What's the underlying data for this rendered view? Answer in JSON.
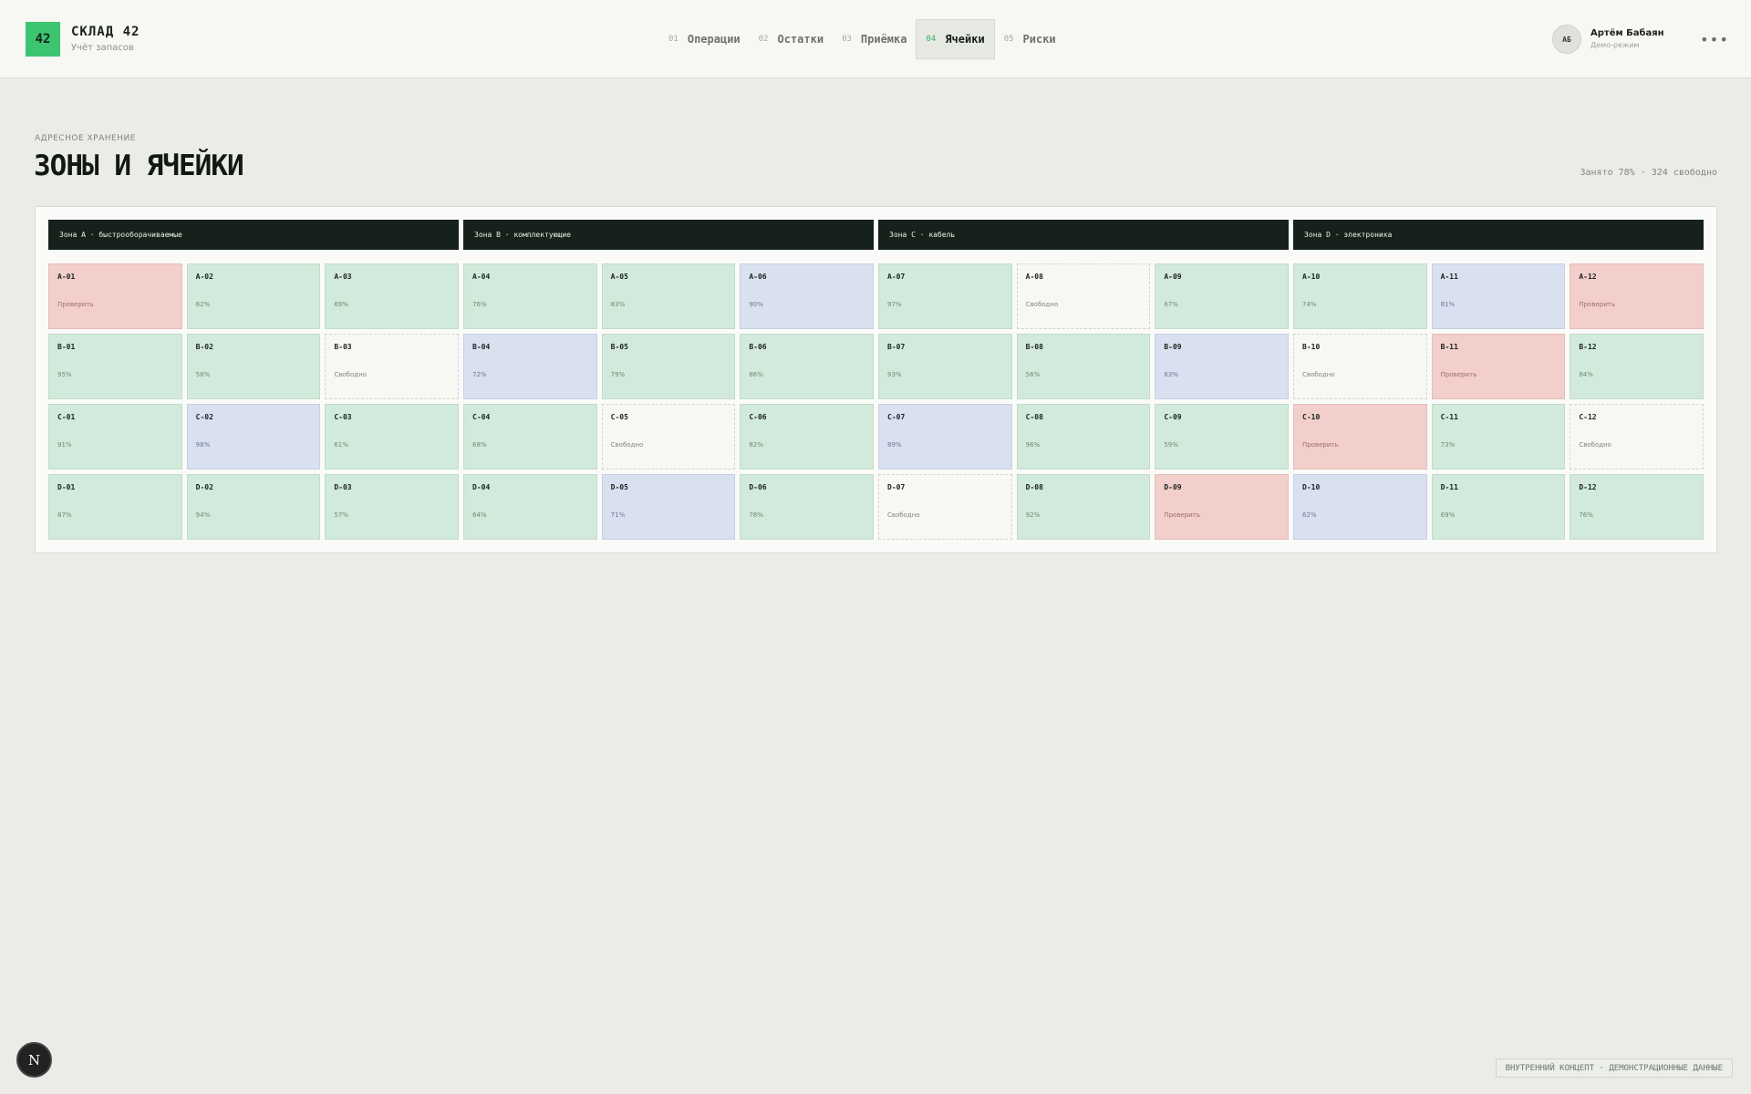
{
  "header": {
    "logo_text": "42",
    "brand_title": "СКЛАД 42",
    "brand_subtitle": "Учёт запасов",
    "nav": [
      {
        "num": "01",
        "label": "Операции"
      },
      {
        "num": "02",
        "label": "Остатки"
      },
      {
        "num": "03",
        "label": "Приёмка"
      },
      {
        "num": "04",
        "label": "Ячейки",
        "active": true
      },
      {
        "num": "05",
        "label": "Риски"
      }
    ],
    "user": {
      "initials": "АБ",
      "name": "Артём Бабаян",
      "role": "Демо-режим"
    },
    "more_label": "•••"
  },
  "page": {
    "eyebrow": "АДРЕСНОЕ ХРАНЕНИЕ",
    "title": "ЗОНЫ И ЯЧЕЙКИ",
    "occupancy": "Занято 78% · 324 свободно"
  },
  "zones": [
    "Зона A · быстрооборачиваемые",
    "Зона B · комплектующие",
    "Зона C · кабель",
    "Зона D · электроника"
  ],
  "cells": [
    [
      {
        "id": "A-01",
        "value": "Проверить",
        "status": "warn"
      },
      {
        "id": "A-02",
        "value": "62%",
        "status": "ok"
      },
      {
        "id": "A-03",
        "value": "69%",
        "status": "ok"
      },
      {
        "id": "A-04",
        "value": "76%",
        "status": "ok"
      },
      {
        "id": "A-05",
        "value": "83%",
        "status": "ok"
      },
      {
        "id": "A-06",
        "value": "90%",
        "status": "info"
      },
      {
        "id": "A-07",
        "value": "97%",
        "status": "ok"
      },
      {
        "id": "A-08",
        "value": "Свободно",
        "status": "free"
      },
      {
        "id": "A-09",
        "value": "67%",
        "status": "ok"
      },
      {
        "id": "A-10",
        "value": "74%",
        "status": "ok"
      },
      {
        "id": "A-11",
        "value": "81%",
        "status": "info"
      },
      {
        "id": "A-12",
        "value": "Проверить",
        "status": "warn"
      }
    ],
    [
      {
        "id": "B-01",
        "value": "95%",
        "status": "ok"
      },
      {
        "id": "B-02",
        "value": "58%",
        "status": "ok"
      },
      {
        "id": "B-03",
        "value": "Свободно",
        "status": "free"
      },
      {
        "id": "B-04",
        "value": "72%",
        "status": "info"
      },
      {
        "id": "B-05",
        "value": "79%",
        "status": "ok"
      },
      {
        "id": "B-06",
        "value": "86%",
        "status": "ok"
      },
      {
        "id": "B-07",
        "value": "93%",
        "status": "ok"
      },
      {
        "id": "B-08",
        "value": "56%",
        "status": "ok"
      },
      {
        "id": "B-09",
        "value": "63%",
        "status": "info"
      },
      {
        "id": "B-10",
        "value": "Свободно",
        "status": "free"
      },
      {
        "id": "B-11",
        "value": "Проверить",
        "status": "warn"
      },
      {
        "id": "B-12",
        "value": "84%",
        "status": "ok"
      }
    ],
    [
      {
        "id": "C-01",
        "value": "91%",
        "status": "ok"
      },
      {
        "id": "C-02",
        "value": "98%",
        "status": "info"
      },
      {
        "id": "C-03",
        "value": "61%",
        "status": "ok"
      },
      {
        "id": "C-04",
        "value": "68%",
        "status": "ok"
      },
      {
        "id": "C-05",
        "value": "Свободно",
        "status": "free"
      },
      {
        "id": "C-06",
        "value": "82%",
        "status": "ok"
      },
      {
        "id": "C-07",
        "value": "89%",
        "status": "info"
      },
      {
        "id": "C-08",
        "value": "96%",
        "status": "ok"
      },
      {
        "id": "C-09",
        "value": "59%",
        "status": "ok"
      },
      {
        "id": "C-10",
        "value": "Проверить",
        "status": "warn"
      },
      {
        "id": "C-11",
        "value": "73%",
        "status": "ok"
      },
      {
        "id": "C-12",
        "value": "Свободно",
        "status": "free"
      }
    ],
    [
      {
        "id": "D-01",
        "value": "87%",
        "status": "ok"
      },
      {
        "id": "D-02",
        "value": "94%",
        "status": "ok"
      },
      {
        "id": "D-03",
        "value": "57%",
        "status": "ok"
      },
      {
        "id": "D-04",
        "value": "64%",
        "status": "ok"
      },
      {
        "id": "D-05",
        "value": "71%",
        "status": "info"
      },
      {
        "id": "D-06",
        "value": "78%",
        "status": "ok"
      },
      {
        "id": "D-07",
        "value": "Свободно",
        "status": "free"
      },
      {
        "id": "D-08",
        "value": "92%",
        "status": "ok"
      },
      {
        "id": "D-09",
        "value": "Проверить",
        "status": "warn"
      },
      {
        "id": "D-10",
        "value": "62%",
        "status": "info"
      },
      {
        "id": "D-11",
        "value": "69%",
        "status": "ok"
      },
      {
        "id": "D-12",
        "value": "76%",
        "status": "ok"
      }
    ]
  ],
  "colors": {
    "accent": "#3cc46e",
    "ok": "#d1eadb",
    "warn": "#f2cfca",
    "info": "#d9e0f0",
    "free": "#f7f8f4",
    "zone_header": "#17211b"
  },
  "footer": {
    "dev_badge": "N",
    "note": "ВНУТРЕННИЙ КОНЦЕПТ · ДЕМОНСТРАЦИОННЫЕ ДАННЫЕ"
  }
}
